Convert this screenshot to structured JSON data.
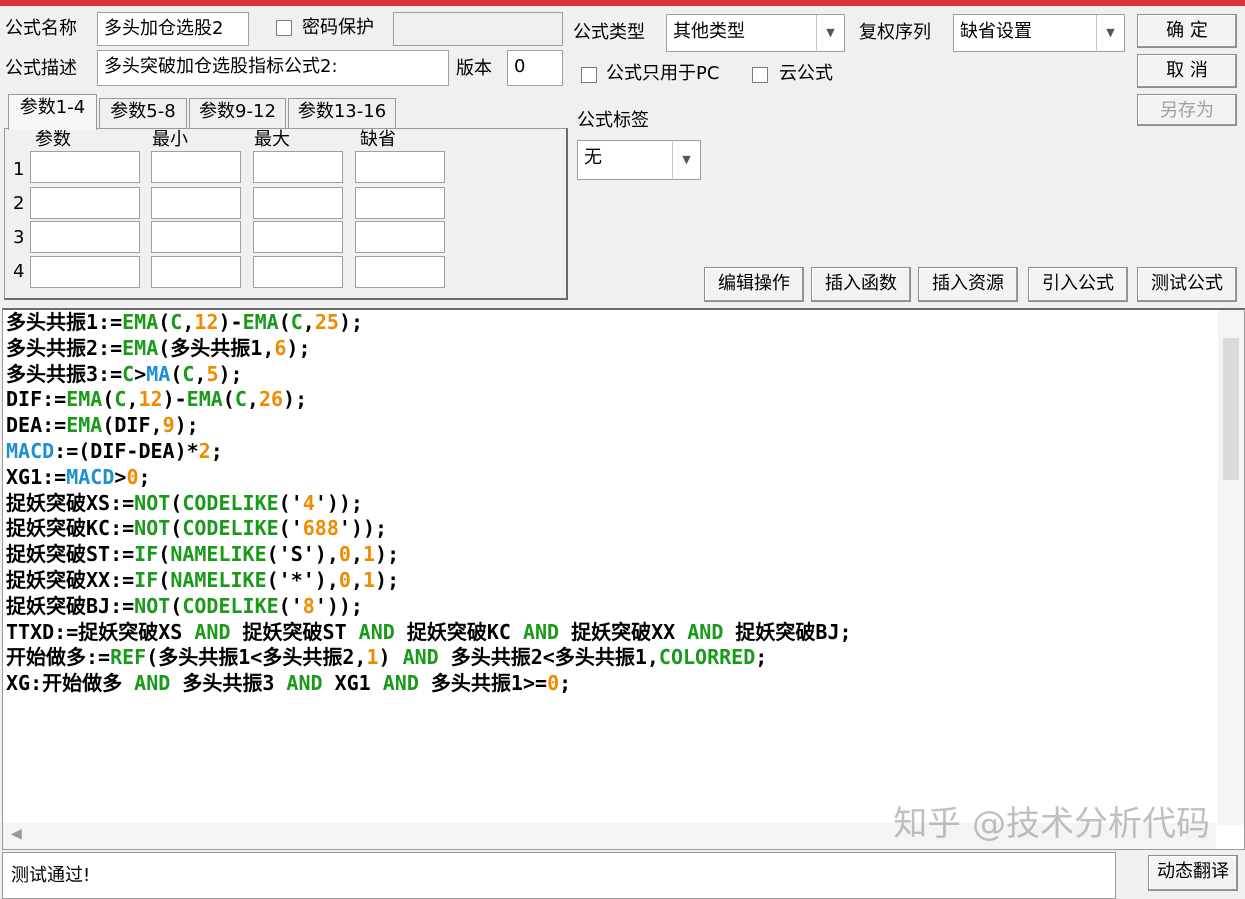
{
  "form": {
    "name_label": "公式名称",
    "name_value": "多头加仓选股2",
    "password_label": "密码保护",
    "password_checked": false,
    "desc_label": "公式描述",
    "desc_value": "多头突破加仓选股指标公式2:",
    "version_label": "版本",
    "version_value": "0",
    "type_label": "公式类型",
    "type_value": "其他类型",
    "rights_label": "复权序列",
    "rights_value": "缺省设置",
    "pc_only_label": "公式只用于PC",
    "pc_only_checked": false,
    "cloud_label": "云公式",
    "cloud_checked": false,
    "tag_label": "公式标签",
    "tag_value": "无"
  },
  "buttons": {
    "ok": "确  定",
    "cancel": "取  消",
    "save_as": "另存为",
    "edit_ops": "编辑操作",
    "insert_func": "插入函数",
    "insert_res": "插入资源",
    "import_formula": "引入公式",
    "test_formula": "测试公式",
    "dyn_translate": "动态翻译"
  },
  "tabs": [
    "参数1-4",
    "参数5-8",
    "参数9-12",
    "参数13-16"
  ],
  "params": {
    "headers": [
      "参数",
      "最小",
      "最大",
      "缺省"
    ],
    "rows": [
      "1",
      "2",
      "3",
      "4"
    ]
  },
  "code_lines": [
    [
      [
        "t",
        "多头共振1:="
      ],
      [
        "k",
        "EMA"
      ],
      [
        "t",
        "("
      ],
      [
        "k",
        "C"
      ],
      [
        "t",
        ","
      ],
      [
        "n",
        "12"
      ],
      [
        "t",
        ")-"
      ],
      [
        "k",
        "EMA"
      ],
      [
        "t",
        "("
      ],
      [
        "k",
        "C"
      ],
      [
        "t",
        ","
      ],
      [
        "n",
        "25"
      ],
      [
        "t",
        ");"
      ]
    ],
    [
      [
        "t",
        "多头共振2:="
      ],
      [
        "k",
        "EMA"
      ],
      [
        "t",
        "(多头共振1,"
      ],
      [
        "n",
        "6"
      ],
      [
        "t",
        ");"
      ]
    ],
    [
      [
        "t",
        "多头共振3:="
      ],
      [
        "k",
        "C"
      ],
      [
        "t",
        ">"
      ],
      [
        "m",
        "MA"
      ],
      [
        "t",
        "("
      ],
      [
        "k",
        "C"
      ],
      [
        "t",
        ","
      ],
      [
        "n",
        "5"
      ],
      [
        "t",
        ");"
      ]
    ],
    [
      [
        "t",
        "DIF:="
      ],
      [
        "k",
        "EMA"
      ],
      [
        "t",
        "("
      ],
      [
        "k",
        "C"
      ],
      [
        "t",
        ","
      ],
      [
        "n",
        "12"
      ],
      [
        "t",
        ")-"
      ],
      [
        "k",
        "EMA"
      ],
      [
        "t",
        "("
      ],
      [
        "k",
        "C"
      ],
      [
        "t",
        ","
      ],
      [
        "n",
        "26"
      ],
      [
        "t",
        ");"
      ]
    ],
    [
      [
        "t",
        "DEA:="
      ],
      [
        "k",
        "EMA"
      ],
      [
        "t",
        "(DIF,"
      ],
      [
        "n",
        "9"
      ],
      [
        "t",
        ");"
      ]
    ],
    [
      [
        "m",
        "MACD"
      ],
      [
        "t",
        ":=(DIF-DEA)*"
      ],
      [
        "n",
        "2"
      ],
      [
        "t",
        ";"
      ]
    ],
    [
      [
        "t",
        "XG1:="
      ],
      [
        "m",
        "MACD"
      ],
      [
        "t",
        ">"
      ],
      [
        "n",
        "0"
      ],
      [
        "t",
        ";"
      ]
    ],
    [
      [
        "t",
        "捉妖突破XS:="
      ],
      [
        "k",
        "NOT"
      ],
      [
        "t",
        "("
      ],
      [
        "k",
        "CODELIKE"
      ],
      [
        "t",
        "('"
      ],
      [
        "n",
        "4"
      ],
      [
        "t",
        "'));"
      ]
    ],
    [
      [
        "t",
        "捉妖突破KC:="
      ],
      [
        "k",
        "NOT"
      ],
      [
        "t",
        "("
      ],
      [
        "k",
        "CODELIKE"
      ],
      [
        "t",
        "('"
      ],
      [
        "n",
        "688"
      ],
      [
        "t",
        "'));"
      ]
    ],
    [
      [
        "t",
        "捉妖突破ST:="
      ],
      [
        "k",
        "IF"
      ],
      [
        "t",
        "("
      ],
      [
        "k",
        "NAMELIKE"
      ],
      [
        "t",
        "('S'),"
      ],
      [
        "n",
        "0"
      ],
      [
        "t",
        ","
      ],
      [
        "n",
        "1"
      ],
      [
        "t",
        ");"
      ]
    ],
    [
      [
        "t",
        "捉妖突破XX:="
      ],
      [
        "k",
        "IF"
      ],
      [
        "t",
        "("
      ],
      [
        "k",
        "NAMELIKE"
      ],
      [
        "t",
        "('*'),"
      ],
      [
        "n",
        "0"
      ],
      [
        "t",
        ","
      ],
      [
        "n",
        "1"
      ],
      [
        "t",
        ");"
      ]
    ],
    [
      [
        "t",
        "捉妖突破BJ:="
      ],
      [
        "k",
        "NOT"
      ],
      [
        "t",
        "("
      ],
      [
        "k",
        "CODELIKE"
      ],
      [
        "t",
        "('"
      ],
      [
        "n",
        "8"
      ],
      [
        "t",
        "'));"
      ]
    ],
    [
      [
        "t",
        "TTXD:=捉妖突破XS "
      ],
      [
        "k",
        "AND"
      ],
      [
        "t",
        " 捉妖突破ST "
      ],
      [
        "k",
        "AND"
      ],
      [
        "t",
        " 捉妖突破KC "
      ],
      [
        "k",
        "AND"
      ],
      [
        "t",
        " 捉妖突破XX "
      ],
      [
        "k",
        "AND"
      ],
      [
        "t",
        " 捉妖突破BJ;"
      ]
    ],
    [
      [
        "t",
        "开始做多:="
      ],
      [
        "k",
        "REF"
      ],
      [
        "t",
        "(多头共振1<多头共振2,"
      ],
      [
        "n",
        "1"
      ],
      [
        "t",
        ") "
      ],
      [
        "k",
        "AND"
      ],
      [
        "t",
        " 多头共振2<多头共振1,"
      ],
      [
        "k",
        "COLORRED"
      ],
      [
        "t",
        ";"
      ]
    ],
    [
      [
        "t",
        "XG:开始做多 "
      ],
      [
        "k",
        "AND"
      ],
      [
        "t",
        " 多头共振3 "
      ],
      [
        "k",
        "AND"
      ],
      [
        "t",
        " XG1 "
      ],
      [
        "k",
        "AND"
      ],
      [
        "t",
        " 多头共振1>="
      ],
      [
        "n",
        "0"
      ],
      [
        "t",
        ";"
      ]
    ]
  ],
  "status_text": "测试通过!",
  "watermark": "知乎 @技术分析代码",
  "colors": {
    "keyword": "#1a9a1a",
    "number": "#f08a00",
    "macd": "#1e90d0",
    "title_bar": "#d9343a"
  }
}
